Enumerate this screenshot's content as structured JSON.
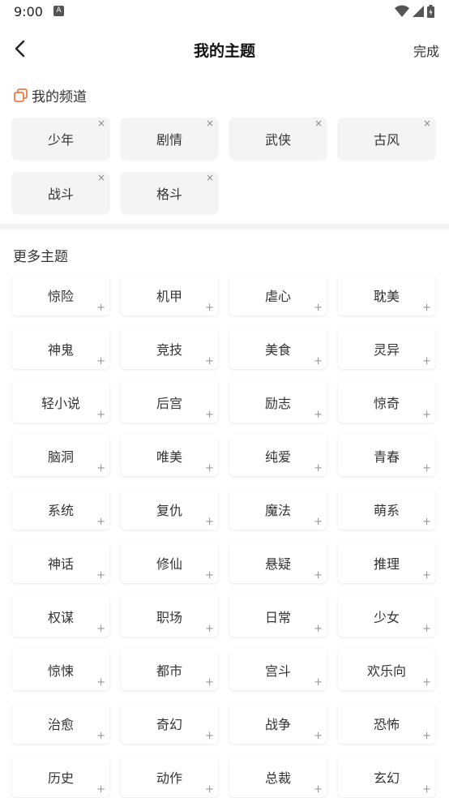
{
  "status_bar": {
    "time": "9:00",
    "notification_icon": "A"
  },
  "header": {
    "title": "我的主题",
    "done_label": "完成"
  },
  "my_channels": {
    "title": "我的频道",
    "items": [
      {
        "label": "少年"
      },
      {
        "label": "剧情"
      },
      {
        "label": "武侠"
      },
      {
        "label": "古风"
      },
      {
        "label": "战斗"
      },
      {
        "label": "格斗"
      }
    ]
  },
  "more_topics": {
    "title": "更多主题",
    "items": [
      {
        "label": "惊险"
      },
      {
        "label": "机甲"
      },
      {
        "label": "虐心"
      },
      {
        "label": "耽美"
      },
      {
        "label": "神鬼"
      },
      {
        "label": "竞技"
      },
      {
        "label": "美食"
      },
      {
        "label": "灵异"
      },
      {
        "label": "轻小说"
      },
      {
        "label": "后宫"
      },
      {
        "label": "励志"
      },
      {
        "label": "惊奇"
      },
      {
        "label": "脑洞"
      },
      {
        "label": "唯美"
      },
      {
        "label": "纯爱"
      },
      {
        "label": "青春"
      },
      {
        "label": "系统"
      },
      {
        "label": "复仇"
      },
      {
        "label": "魔法"
      },
      {
        "label": "萌系"
      },
      {
        "label": "神话"
      },
      {
        "label": "修仙"
      },
      {
        "label": "悬疑"
      },
      {
        "label": "推理"
      },
      {
        "label": "权谋"
      },
      {
        "label": "职场"
      },
      {
        "label": "日常"
      },
      {
        "label": "少女"
      },
      {
        "label": "惊悚"
      },
      {
        "label": "都市"
      },
      {
        "label": "宫斗"
      },
      {
        "label": "欢乐向"
      },
      {
        "label": "治愈"
      },
      {
        "label": "奇幻"
      },
      {
        "label": "战争"
      },
      {
        "label": "恐怖"
      },
      {
        "label": "历史"
      },
      {
        "label": "动作"
      },
      {
        "label": "总裁"
      },
      {
        "label": "玄幻"
      }
    ]
  },
  "icons": {
    "back": "chevron-left-icon",
    "channel": "copy-stack-icon",
    "remove": "close-icon",
    "add": "plus-icon"
  },
  "colors": {
    "accent": "#f07a4b",
    "chip_bg": "#f4f4f4",
    "divider": "#f3f3f3"
  }
}
